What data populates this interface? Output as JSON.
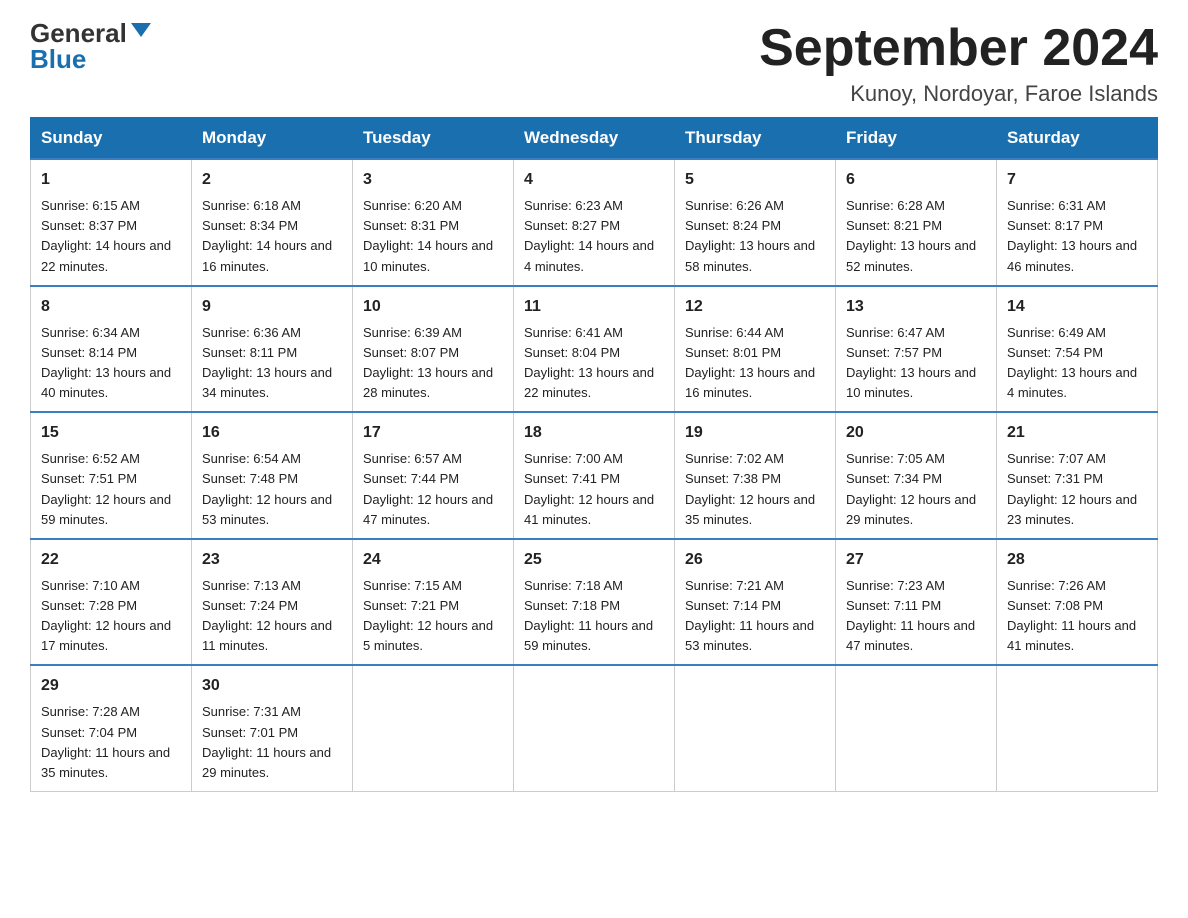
{
  "header": {
    "logo_general": "General",
    "logo_blue": "Blue",
    "month_title": "September 2024",
    "location": "Kunoy, Nordoyar, Faroe Islands"
  },
  "days_of_week": [
    "Sunday",
    "Monday",
    "Tuesday",
    "Wednesday",
    "Thursday",
    "Friday",
    "Saturday"
  ],
  "weeks": [
    [
      {
        "day": "1",
        "sunrise": "Sunrise: 6:15 AM",
        "sunset": "Sunset: 8:37 PM",
        "daylight": "Daylight: 14 hours and 22 minutes."
      },
      {
        "day": "2",
        "sunrise": "Sunrise: 6:18 AM",
        "sunset": "Sunset: 8:34 PM",
        "daylight": "Daylight: 14 hours and 16 minutes."
      },
      {
        "day": "3",
        "sunrise": "Sunrise: 6:20 AM",
        "sunset": "Sunset: 8:31 PM",
        "daylight": "Daylight: 14 hours and 10 minutes."
      },
      {
        "day": "4",
        "sunrise": "Sunrise: 6:23 AM",
        "sunset": "Sunset: 8:27 PM",
        "daylight": "Daylight: 14 hours and 4 minutes."
      },
      {
        "day": "5",
        "sunrise": "Sunrise: 6:26 AM",
        "sunset": "Sunset: 8:24 PM",
        "daylight": "Daylight: 13 hours and 58 minutes."
      },
      {
        "day": "6",
        "sunrise": "Sunrise: 6:28 AM",
        "sunset": "Sunset: 8:21 PM",
        "daylight": "Daylight: 13 hours and 52 minutes."
      },
      {
        "day": "7",
        "sunrise": "Sunrise: 6:31 AM",
        "sunset": "Sunset: 8:17 PM",
        "daylight": "Daylight: 13 hours and 46 minutes."
      }
    ],
    [
      {
        "day": "8",
        "sunrise": "Sunrise: 6:34 AM",
        "sunset": "Sunset: 8:14 PM",
        "daylight": "Daylight: 13 hours and 40 minutes."
      },
      {
        "day": "9",
        "sunrise": "Sunrise: 6:36 AM",
        "sunset": "Sunset: 8:11 PM",
        "daylight": "Daylight: 13 hours and 34 minutes."
      },
      {
        "day": "10",
        "sunrise": "Sunrise: 6:39 AM",
        "sunset": "Sunset: 8:07 PM",
        "daylight": "Daylight: 13 hours and 28 minutes."
      },
      {
        "day": "11",
        "sunrise": "Sunrise: 6:41 AM",
        "sunset": "Sunset: 8:04 PM",
        "daylight": "Daylight: 13 hours and 22 minutes."
      },
      {
        "day": "12",
        "sunrise": "Sunrise: 6:44 AM",
        "sunset": "Sunset: 8:01 PM",
        "daylight": "Daylight: 13 hours and 16 minutes."
      },
      {
        "day": "13",
        "sunrise": "Sunrise: 6:47 AM",
        "sunset": "Sunset: 7:57 PM",
        "daylight": "Daylight: 13 hours and 10 minutes."
      },
      {
        "day": "14",
        "sunrise": "Sunrise: 6:49 AM",
        "sunset": "Sunset: 7:54 PM",
        "daylight": "Daylight: 13 hours and 4 minutes."
      }
    ],
    [
      {
        "day": "15",
        "sunrise": "Sunrise: 6:52 AM",
        "sunset": "Sunset: 7:51 PM",
        "daylight": "Daylight: 12 hours and 59 minutes."
      },
      {
        "day": "16",
        "sunrise": "Sunrise: 6:54 AM",
        "sunset": "Sunset: 7:48 PM",
        "daylight": "Daylight: 12 hours and 53 minutes."
      },
      {
        "day": "17",
        "sunrise": "Sunrise: 6:57 AM",
        "sunset": "Sunset: 7:44 PM",
        "daylight": "Daylight: 12 hours and 47 minutes."
      },
      {
        "day": "18",
        "sunrise": "Sunrise: 7:00 AM",
        "sunset": "Sunset: 7:41 PM",
        "daylight": "Daylight: 12 hours and 41 minutes."
      },
      {
        "day": "19",
        "sunrise": "Sunrise: 7:02 AM",
        "sunset": "Sunset: 7:38 PM",
        "daylight": "Daylight: 12 hours and 35 minutes."
      },
      {
        "day": "20",
        "sunrise": "Sunrise: 7:05 AM",
        "sunset": "Sunset: 7:34 PM",
        "daylight": "Daylight: 12 hours and 29 minutes."
      },
      {
        "day": "21",
        "sunrise": "Sunrise: 7:07 AM",
        "sunset": "Sunset: 7:31 PM",
        "daylight": "Daylight: 12 hours and 23 minutes."
      }
    ],
    [
      {
        "day": "22",
        "sunrise": "Sunrise: 7:10 AM",
        "sunset": "Sunset: 7:28 PM",
        "daylight": "Daylight: 12 hours and 17 minutes."
      },
      {
        "day": "23",
        "sunrise": "Sunrise: 7:13 AM",
        "sunset": "Sunset: 7:24 PM",
        "daylight": "Daylight: 12 hours and 11 minutes."
      },
      {
        "day": "24",
        "sunrise": "Sunrise: 7:15 AM",
        "sunset": "Sunset: 7:21 PM",
        "daylight": "Daylight: 12 hours and 5 minutes."
      },
      {
        "day": "25",
        "sunrise": "Sunrise: 7:18 AM",
        "sunset": "Sunset: 7:18 PM",
        "daylight": "Daylight: 11 hours and 59 minutes."
      },
      {
        "day": "26",
        "sunrise": "Sunrise: 7:21 AM",
        "sunset": "Sunset: 7:14 PM",
        "daylight": "Daylight: 11 hours and 53 minutes."
      },
      {
        "day": "27",
        "sunrise": "Sunrise: 7:23 AM",
        "sunset": "Sunset: 7:11 PM",
        "daylight": "Daylight: 11 hours and 47 minutes."
      },
      {
        "day": "28",
        "sunrise": "Sunrise: 7:26 AM",
        "sunset": "Sunset: 7:08 PM",
        "daylight": "Daylight: 11 hours and 41 minutes."
      }
    ],
    [
      {
        "day": "29",
        "sunrise": "Sunrise: 7:28 AM",
        "sunset": "Sunset: 7:04 PM",
        "daylight": "Daylight: 11 hours and 35 minutes."
      },
      {
        "day": "30",
        "sunrise": "Sunrise: 7:31 AM",
        "sunset": "Sunset: 7:01 PM",
        "daylight": "Daylight: 11 hours and 29 minutes."
      },
      null,
      null,
      null,
      null,
      null
    ]
  ]
}
